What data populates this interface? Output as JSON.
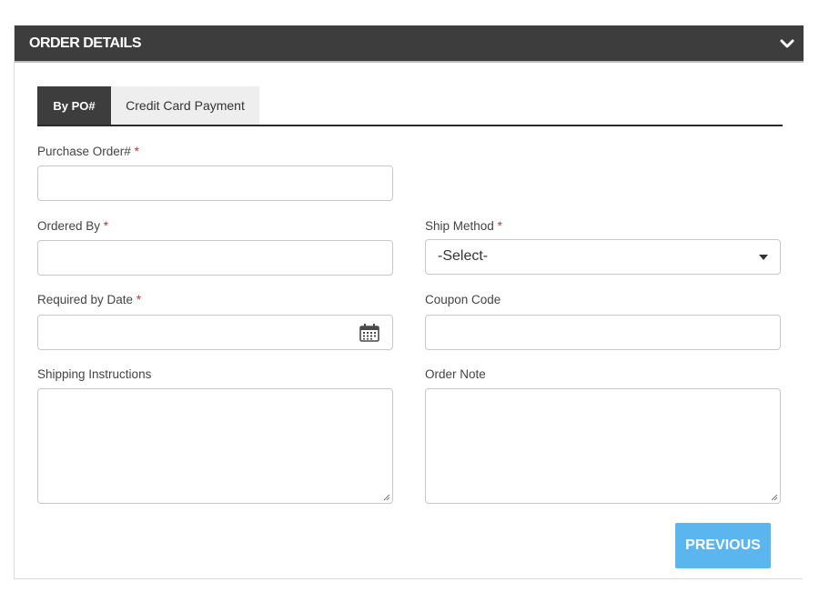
{
  "header": {
    "title": "ORDER DETAILS",
    "toggle_icon": "chevron-down-icon"
  },
  "tabs": [
    {
      "label": "By PO#",
      "active": true
    },
    {
      "label": "Credit Card Payment",
      "active": false
    }
  ],
  "fields": {
    "purchase_order": {
      "label": "Purchase Order#",
      "required_mark": "*",
      "value": ""
    },
    "ordered_by": {
      "label": "Ordered By",
      "required_mark": "*",
      "value": ""
    },
    "ship_method": {
      "label": "Ship Method",
      "required_mark": "*",
      "selected": "-Select-"
    },
    "required_date": {
      "label": "Required by Date",
      "required_mark": "*",
      "value": "",
      "icon": "calendar-icon"
    },
    "coupon_code": {
      "label": "Coupon Code",
      "value": ""
    },
    "shipping_instructions": {
      "label": "Shipping Instructions",
      "value": ""
    },
    "order_note": {
      "label": "Order Note",
      "value": ""
    }
  },
  "buttons": {
    "previous": "PREVIOUS"
  },
  "colors": {
    "header_bg": "#3d3d3d",
    "accent_button": "#5bb5ef",
    "required": "#c0392b"
  }
}
